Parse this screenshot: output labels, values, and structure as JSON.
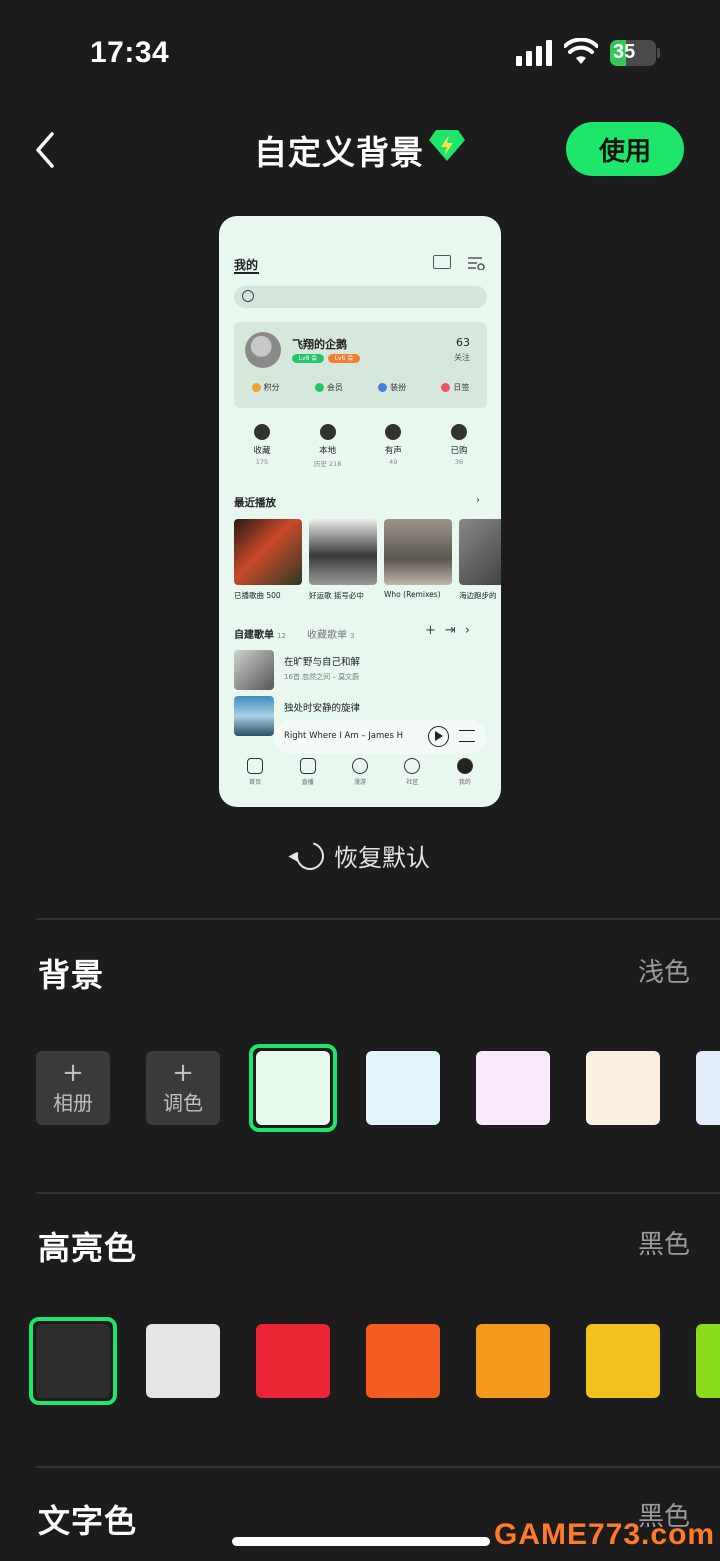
{
  "status": {
    "time": "17:34",
    "battery": "35",
    "battery_level": 0.35
  },
  "header": {
    "title": "自定义背景",
    "use_label": "使用"
  },
  "preview": {
    "tab_label": "我的",
    "user_name": "飞翔的企鹅",
    "badge1": "Lv8 会",
    "badge2": "Lv6 会",
    "follow_count": "63",
    "follow_label": "关注",
    "shortcuts": [
      "积分",
      "会员",
      "装扮",
      "日签"
    ],
    "quick": [
      {
        "label": "收藏",
        "sub": "175"
      },
      {
        "label": "本地",
        "sub": "历史 218"
      },
      {
        "label": "有声",
        "sub": "49"
      },
      {
        "label": "已购",
        "sub": "36"
      }
    ],
    "recent_title": "最近播放",
    "recent": [
      {
        "caption": "已播歌曲 500",
        "color": "#3a2a22"
      },
      {
        "caption": "好运歌 摇号必中",
        "color": "#d8d8d8"
      },
      {
        "caption": "Who (Remixes)",
        "color": "#a8a29a"
      },
      {
        "caption": "海边跑步的",
        "color": "#555555"
      }
    ],
    "lists_tab": "自建歌单",
    "lists_count": "12",
    "collect_tab": "收藏歌单",
    "collect_count": "3",
    "songs": [
      {
        "title": "在旷野与自己和解",
        "sub": "16首 忽然之间 – 莫文蔚"
      },
      {
        "title": "独处时安静的旋律",
        "sub": ""
      }
    ],
    "now_playing": "Right Where I Am – James H",
    "nav": [
      "首页",
      "直播",
      "漫游",
      "社区",
      "我的"
    ]
  },
  "restore_label": "恢复默认",
  "background": {
    "title": "背景",
    "value": "浅色",
    "album_label": "相册",
    "mix_label": "调色",
    "swatches": [
      "#e6fbea",
      "#e2f5fc",
      "#f9e9fb",
      "#fdefe0",
      "#e3ecfb"
    ]
  },
  "highlight": {
    "title": "高亮色",
    "value": "黑色",
    "swatches": [
      "#2c2c2c",
      "#e6e6e6",
      "#ec2536",
      "#f55c20",
      "#f59a1c",
      "#f0c11f",
      "#8bdc1a"
    ]
  },
  "text_color": {
    "title": "文字色",
    "value": "黑色"
  },
  "watermark": "GAME773.com"
}
